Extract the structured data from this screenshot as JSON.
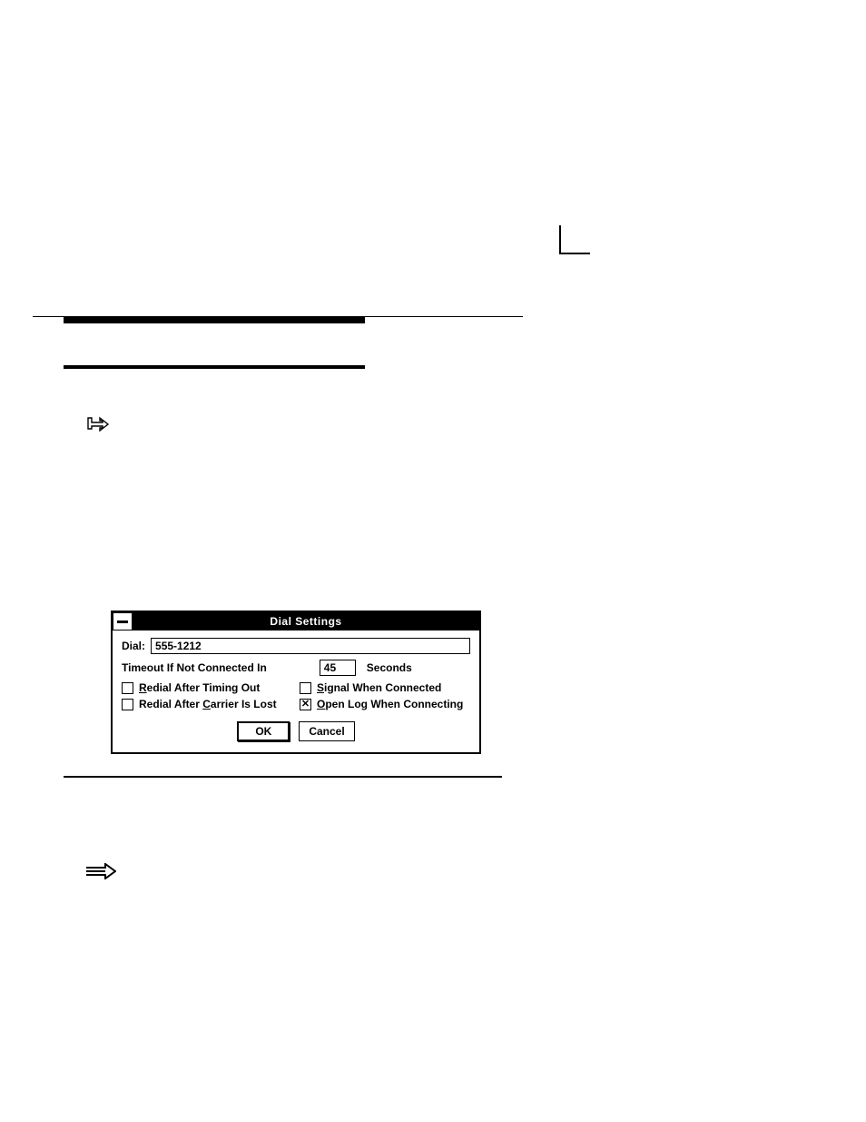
{
  "dialog": {
    "title": "Dial Settings",
    "dial_label": "Dial:",
    "dial_value": "555-1212",
    "timeout_label": "Timeout If Not Connected In",
    "timeout_value": "45",
    "seconds_label": "Seconds",
    "checks": {
      "redial_timeout": {
        "prefix": "R",
        "rest": "edial After Timing Out",
        "checked": false
      },
      "signal_connected": {
        "prefix": "S",
        "rest": "ignal When Connected",
        "checked": false
      },
      "redial_carrier": {
        "prefix": "C",
        "pre": "Redial After ",
        "rest": "arrier Is Lost",
        "checked": false
      },
      "open_log": {
        "prefix": "O",
        "rest": "pen Log When Connecting",
        "checked": true
      }
    },
    "ok_label": "OK",
    "cancel_label": "Cancel"
  }
}
